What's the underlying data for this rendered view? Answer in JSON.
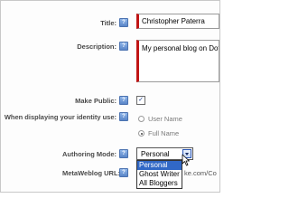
{
  "form": {
    "title": {
      "label": "Title:",
      "value": "Christopher Paterra"
    },
    "description": {
      "label": "Description:",
      "value": "My personal blog on DotN"
    },
    "make_public": {
      "label": "Make Public:",
      "checked": true,
      "check_glyph": "✓"
    },
    "identity": {
      "label": "When displaying your identity use:",
      "options": [
        {
          "label": "User Name",
          "selected": false
        },
        {
          "label": "Full Name",
          "selected": true
        }
      ]
    },
    "authoring_mode": {
      "label": "Authoring Mode:",
      "value": "Personal",
      "options": [
        "Personal",
        "Ghost Writer",
        "All Bloggers"
      ],
      "highlighted_index": 0
    },
    "metaweblog": {
      "label": "MetaWeblog URL:",
      "partial_text": "ke.com/Co"
    }
  },
  "help_icon_glyph": "?",
  "colors": {
    "required_marker": "#c01414",
    "highlight": "#3168c6",
    "help_icon": "#5a86c8"
  }
}
